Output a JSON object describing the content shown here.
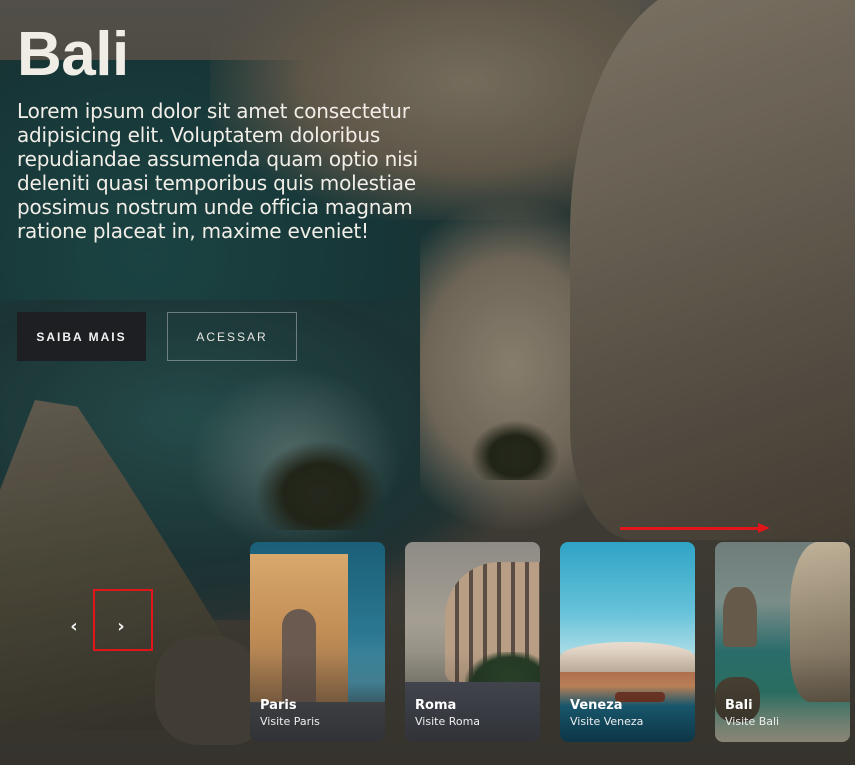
{
  "hero": {
    "title": "Bali",
    "description": "Lorem ipsum dolor sit amet consectetur adipisicing elit. Voluptatem doloribus repudiandae assumenda quam optio nisi deleniti quasi temporibus quis molestiae possimus nostrum unde officia magnam ratione placeat in, maxime eveniet!",
    "primary_button": "SAIBA MAIS",
    "secondary_button": "ACESSAR"
  },
  "carousel": {
    "prev_label": "‹",
    "next_label": "›",
    "cards": [
      {
        "name": "Paris",
        "sub": "Visite Paris"
      },
      {
        "name": "Roma",
        "sub": "Visite Roma"
      },
      {
        "name": "Veneza",
        "sub": "Visite Veneza"
      },
      {
        "name": "Bali",
        "sub": "Visite Bali"
      }
    ]
  },
  "colors": {
    "annotation": "#e0161b",
    "primary_button_bg": "#1e1f22"
  }
}
